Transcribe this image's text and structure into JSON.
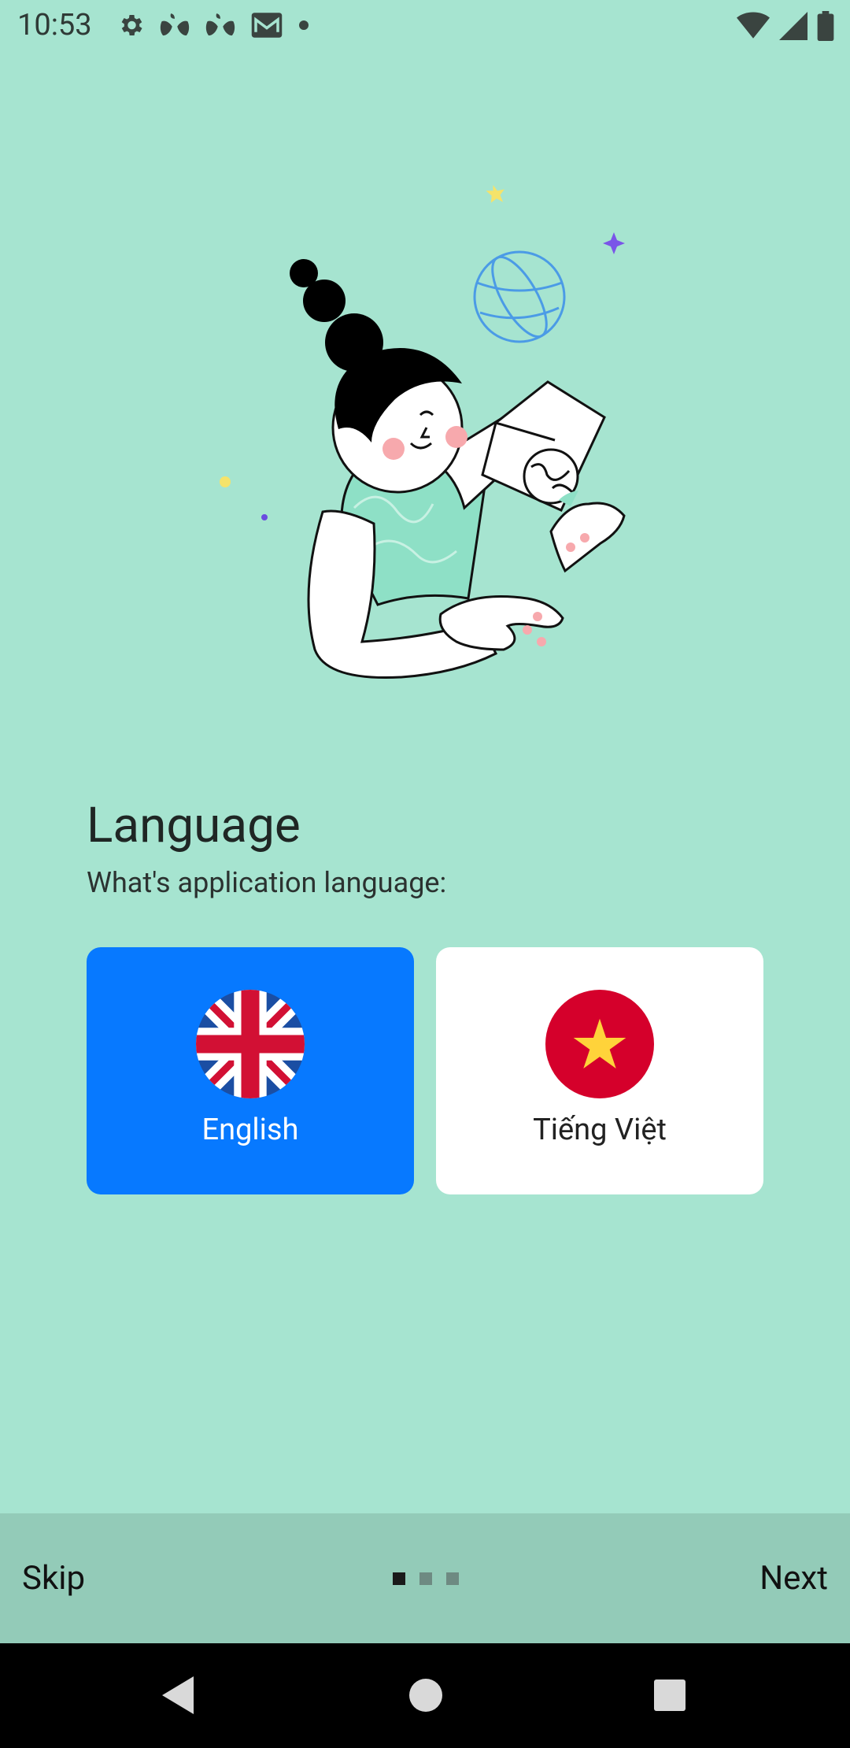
{
  "status_bar": {
    "time": "10:53",
    "icons": [
      "gear-icon",
      "app-icon-1",
      "app-icon-2",
      "mail-icon",
      "dot-icon",
      "wifi-icon",
      "signal-icon",
      "battery-icon"
    ]
  },
  "onboarding": {
    "title": "Language",
    "subtitle": "What's application language:",
    "options": [
      {
        "label": "English",
        "flag": "uk-flag-icon",
        "selected": true
      },
      {
        "label": "Tiếng Việt",
        "flag": "vietnam-flag-icon",
        "selected": false
      }
    ],
    "page_indicator": {
      "current": 1,
      "total": 3
    }
  },
  "bottom_bar": {
    "skip_label": "Skip",
    "next_label": "Next"
  },
  "colors": {
    "background": "#a6e4d0",
    "bottom_bar": "#93cbb8",
    "selected_card": "#0779ff",
    "unselected_card": "#ffffff"
  },
  "nav_bar": {
    "icons": [
      "back-icon",
      "home-icon",
      "recents-icon"
    ]
  }
}
